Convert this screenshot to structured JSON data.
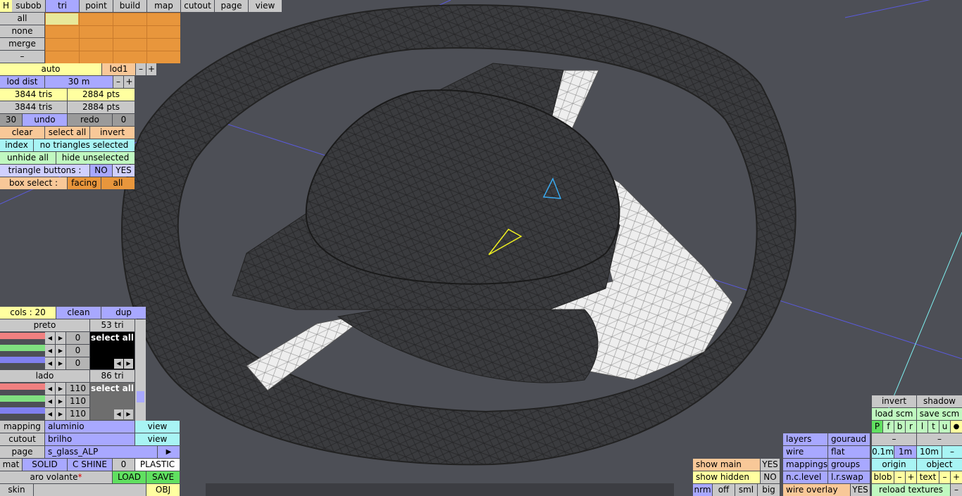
{
  "top_tabs": [
    "H",
    "subob",
    "tri",
    "point",
    "build",
    "map",
    "cutout",
    "page",
    "view"
  ],
  "select_rows": [
    "all",
    "none",
    "merge",
    "–"
  ],
  "lod": {
    "auto": "auto",
    "level": "lod1",
    "minus": "–",
    "plus": "+",
    "dist_label": "lod dist",
    "dist_value": "30 m"
  },
  "counts": {
    "tris_total": "3844 tris",
    "pts_total": "2884 pts",
    "tris_vis": "3844 tris",
    "pts_vis": "2884 pts"
  },
  "undo": {
    "count": "30",
    "undo": "undo",
    "redo": "redo",
    "redo_count": "0"
  },
  "selection": {
    "clear": "clear",
    "select_all": "select all",
    "invert": "invert",
    "index": "index",
    "status": "no triangles selected",
    "unhide_all": "unhide all",
    "hide_unselected": "hide unselected",
    "tri_buttons_label": "triangle buttons :",
    "no": "NO",
    "yes": "YES",
    "box_select_label": "box select :",
    "facing": "facing",
    "all": "all"
  },
  "colors_panel": {
    "cols": "cols : 20",
    "clean": "clean",
    "dup": "dup",
    "mat1": {
      "name": "preto",
      "tris": "53 tri",
      "r": "0",
      "g": "0",
      "b": "0",
      "select_all": "select all",
      "swatch": "#000000"
    },
    "mat2": {
      "name": "lado",
      "tris": "86 tri",
      "r": "110",
      "g": "110",
      "b": "110",
      "select_all": "select all",
      "swatch": "#6e6e6e"
    }
  },
  "bottom_left": {
    "mapping": "mapping",
    "mapping_val": "aluminio",
    "cutout": "cutout",
    "cutout_val": "brilho",
    "page": "page",
    "page_val": "s_glass_ALP",
    "arrow": "▶",
    "view": "view",
    "mat": "mat",
    "solid": "SOLID",
    "cshine": "C SHINE",
    "zero": "0",
    "plastic": "PLASTIC",
    "object_name": "aro volante",
    "star": "*",
    "load": "LOAD",
    "save": "SAVE",
    "skin": "skin",
    "obj": "OBJ"
  },
  "bottom_right": {
    "show_main": "show main",
    "yes": "YES",
    "show_hidden": "show hidden",
    "no": "NO",
    "nrm": "nrm",
    "off": "off",
    "sml": "sml",
    "big": "big",
    "layers": "layers",
    "gouraud": "gouraud",
    "wire": "wire",
    "flat": "flat",
    "mappings": "mappings",
    "groups": "groups",
    "nclevel": "n.c.level",
    "lrswap": "l.r.swap",
    "wire_overlay": "wire overlay",
    "wo_yes": "YES",
    "invert": "invert",
    "shadow": "shadow",
    "load_scm": "load scm",
    "save_scm": "save scm",
    "letters": [
      "P",
      "f",
      "b",
      "r",
      "l",
      "t",
      "u"
    ],
    "dot": "●",
    "dash": "–",
    "s01": "0.1m",
    "s1": "1m",
    "s10": "10m",
    "origin": "origin",
    "object": "object",
    "blob": "blob",
    "plus": "+",
    "text": "text",
    "reload": "reload textures"
  },
  "accents": {
    "blue": "#a8a8ff",
    "cyan": "#a8f4f4",
    "yellow": "#ffffa0",
    "orange": "#e8963c"
  }
}
